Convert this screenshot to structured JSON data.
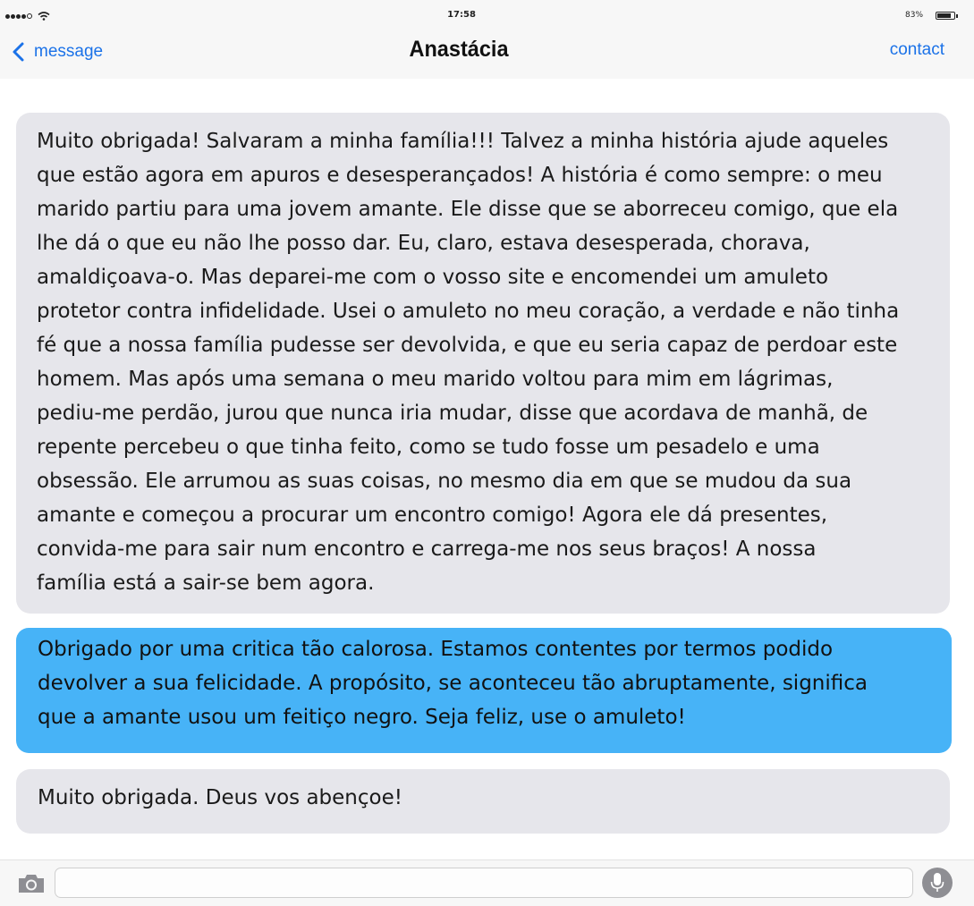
{
  "status_bar": {
    "time": "17:58",
    "battery_percent": "83%",
    "battery_level": 0.83,
    "signal_bars_filled": 4,
    "signal_bars_total": 5
  },
  "nav": {
    "back_label": "message",
    "title": "Anastácia",
    "contact_label": "contact"
  },
  "messages": [
    {
      "direction": "incoming",
      "text": "Muito obrigada! Salvaram a minha família!!! Talvez a minha história ajude aqueles\nque estão agora em apuros e desesperançados! A história é como sempre: o meu\nmarido partiu para uma jovem amante. Ele disse que se aborreceu comigo, que ela\nlhe dá o que eu não lhe posso dar. Eu, claro, estava desesperada, chorava,\namaldiçoava-o. Mas deparei-me com o vosso site e encomendei um amuleto\nprotetor contra infidelidade. Usei o amuleto no meu coração, a verdade e não tinha\nfé que a nossa família pudesse ser devolvida, e que eu seria capaz de perdoar este\nhomem. Mas após uma semana o meu marido voltou para mim em lágrimas,\npediu-me perdão, jurou que nunca iria mudar, disse que acordava de manhã, de\nrepente percebeu o que tinha feito, como se tudo fosse um pesadelo e uma\nobsessão. Ele arrumou as suas coisas, no mesmo dia em que se mudou da sua\namante e começou a procurar um encontro comigo! Agora ele dá presentes,\nconvida-me para sair num encontro e carrega-me nos seus braços! A nossa\nfamília está a sair-se bem agora."
    },
    {
      "direction": "outgoing",
      "text": "Obrigado por uma critica tão calorosa. Estamos contentes por termos podido\ndevolver a sua felicidade. A propósito, se aconteceu tão abruptamente, significa\nque a amante usou um feitiço negro. Seja feliz, use o amuleto!"
    },
    {
      "direction": "incoming",
      "text": "Muito obrigada. Deus vos abençoe!"
    }
  ],
  "composer": {
    "value": "",
    "placeholder": "",
    "camera_icon": "camera-icon",
    "mic_icon": "microphone-icon"
  },
  "colors": {
    "accent": "#1b72e8",
    "incoming_bubble": "#e6e6eb",
    "outgoing_bubble": "#47b3f7",
    "bar_background": "#f7f7f7"
  }
}
